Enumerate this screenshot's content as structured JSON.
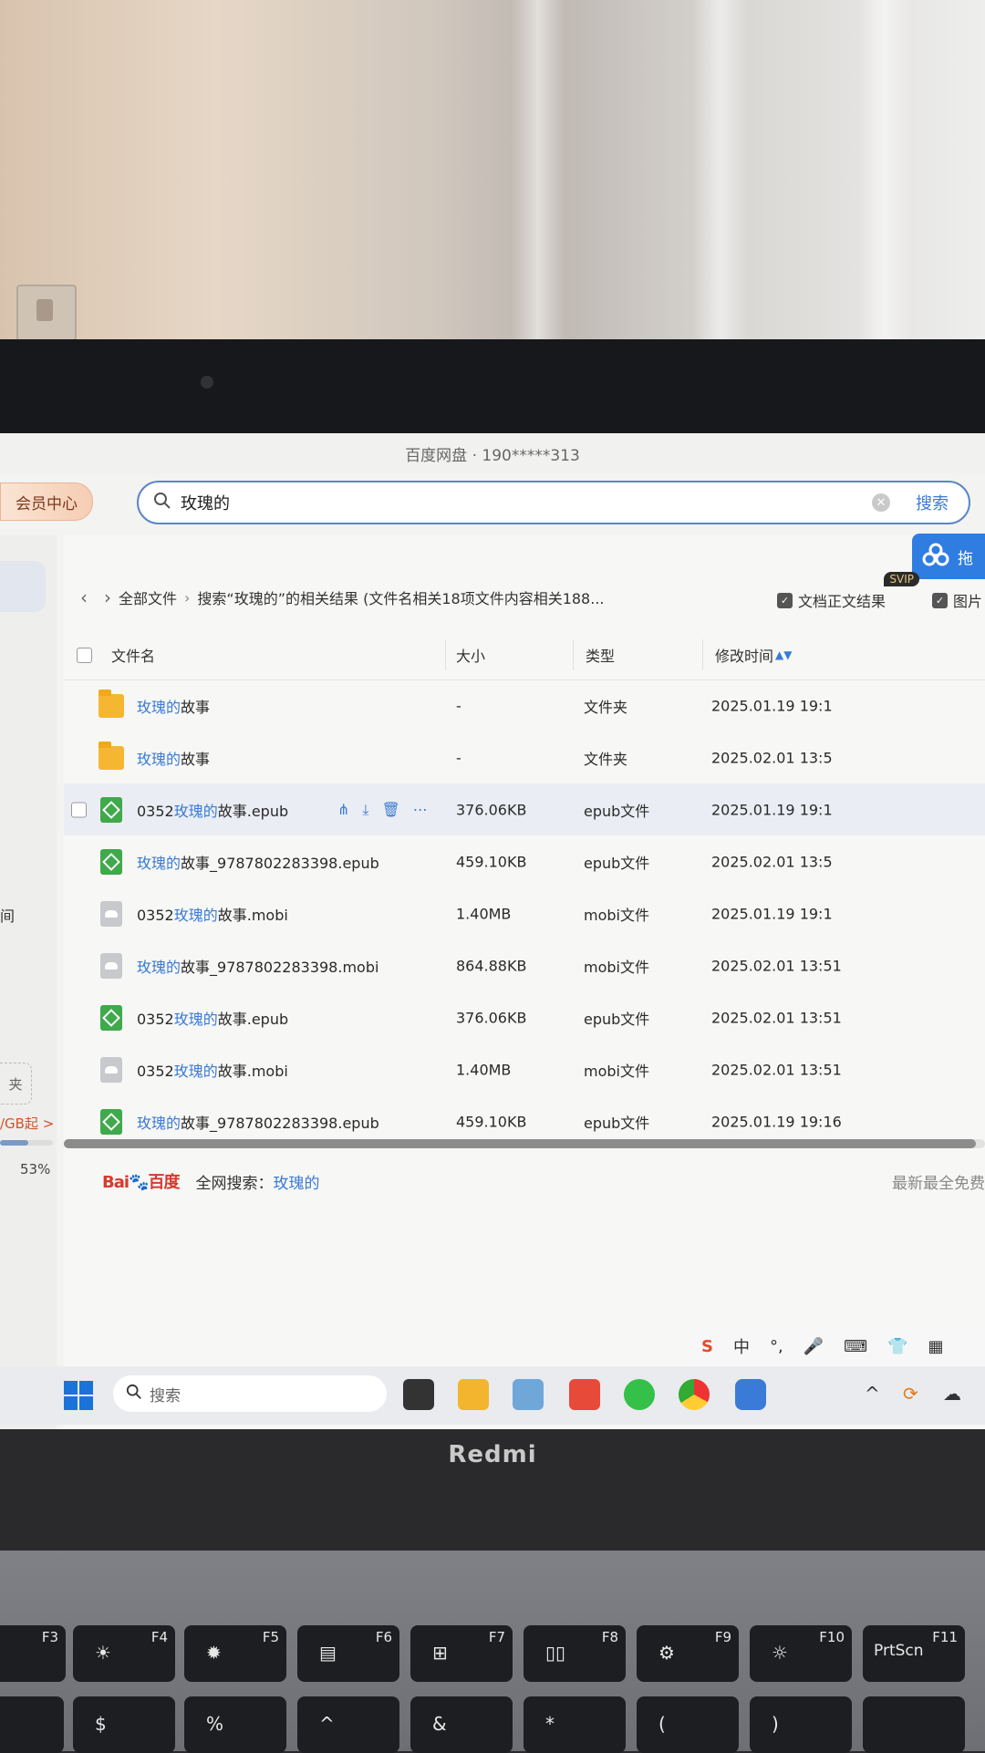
{
  "window": {
    "title": "百度网盘 · 190*****313"
  },
  "topbar": {
    "vip_label": "会员中心",
    "search_value": "玫瑰的",
    "search_button": "搜索"
  },
  "brand_button": {
    "label": "拖",
    "badge": "SVIP"
  },
  "breadcrumb": {
    "root": "全部文件",
    "current": "搜索“玫瑰的”的相关结果 (文件名相关18项文件内容相关188..."
  },
  "options": {
    "fulltext": "文档正文结果",
    "images": "图片"
  },
  "table": {
    "headers": {
      "name": "文件名",
      "size": "大小",
      "type": "类型",
      "modified": "修改时间"
    },
    "rows": [
      {
        "hl": "玫瑰的",
        "pre": "",
        "post": "故事",
        "size": "-",
        "type": "文件夹",
        "time": "2025.01.19 19:1",
        "icon": "folder-icon"
      },
      {
        "hl": "玫瑰的",
        "pre": "",
        "post": "故事",
        "size": "-",
        "type": "文件夹",
        "time": "2025.02.01 13:5",
        "icon": "folder-icon"
      },
      {
        "hl": "玫瑰的",
        "pre": "0352",
        "post": "故事.epub",
        "size": "376.06KB",
        "type": "epub文件",
        "time": "2025.01.19 19:1",
        "icon": "epub-icon"
      },
      {
        "hl": "玫瑰的",
        "pre": "",
        "post": "故事_9787802283398.epub",
        "size": "459.10KB",
        "type": "epub文件",
        "time": "2025.02.01 13:5",
        "icon": "epub-icon"
      },
      {
        "hl": "玫瑰的",
        "pre": "0352",
        "post": "故事.mobi",
        "size": "1.40MB",
        "type": "mobi文件",
        "time": "2025.01.19 19:1",
        "icon": "mobi-icon"
      },
      {
        "hl": "玫瑰的",
        "pre": "",
        "post": "故事_9787802283398.mobi",
        "size": "864.88KB",
        "type": "mobi文件",
        "time": "2025.02.01 13:51",
        "icon": "mobi-icon"
      },
      {
        "hl": "玫瑰的",
        "pre": "0352",
        "post": "故事.epub",
        "size": "376.06KB",
        "type": "epub文件",
        "time": "2025.02.01 13:51",
        "icon": "epub-icon"
      },
      {
        "hl": "玫瑰的",
        "pre": "0352",
        "post": "故事.mobi",
        "size": "1.40MB",
        "type": "mobi文件",
        "time": "2025.02.01 13:51",
        "icon": "mobi-icon"
      },
      {
        "hl": "玫瑰的",
        "pre": "",
        "post": "故事_9787802283398.epub",
        "size": "459.10KB",
        "type": "epub文件",
        "time": "2025.01.19 19:16",
        "icon": "epub-icon"
      }
    ]
  },
  "footer": {
    "logo_a": "Bai",
    "logo_b": "百度",
    "label": "全网搜索：",
    "query": "玫瑰的",
    "right": "最新最全免费"
  },
  "sidebar": {
    "time_label": "间",
    "folder_label": "夹",
    "upgrade": "/GB起 >",
    "usage": "53%"
  },
  "ime": {
    "lang": "中"
  },
  "taskbar": {
    "search_placeholder": "搜索"
  },
  "laptop_brand": "Redmi",
  "keys": {
    "f3": "F3",
    "f4": "F4",
    "f5": "F5",
    "f6": "F6",
    "f7": "F7",
    "f8": "F8",
    "f9": "F9",
    "f10": "F10",
    "f11": "F11",
    "prtscn": "PrtScn",
    "dollar": "$",
    "percent": "%",
    "caret": "^",
    "amp": "&",
    "star": "*",
    "lparen": "(",
    "rparen": ")"
  },
  "colors": {
    "accent": "#3a7bd5",
    "epub": "#3fa94b",
    "folder": "#f5b731",
    "mobi": "#c7c9cc"
  }
}
